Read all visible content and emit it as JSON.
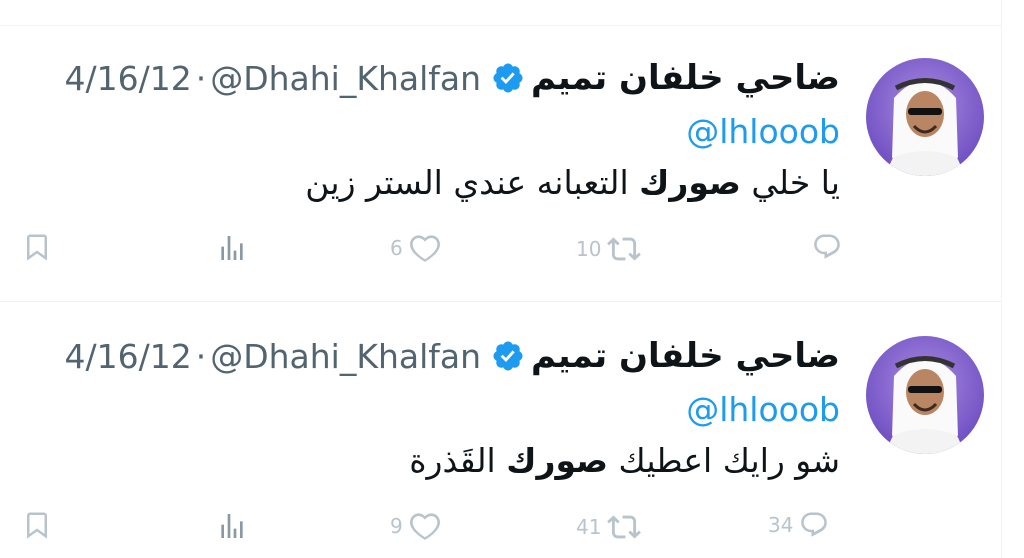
{
  "tweets": [
    {
      "author_name": "ضاحي خلفان تميم",
      "handle": "@Dhahi_Khalfan",
      "separator": "·",
      "date": "4/16/12",
      "reply_to": "@lhlooob",
      "text_parts": [
        "يا خلي ",
        "صورك",
        " التعبانه عندي الستر زين"
      ],
      "stats": {
        "replies": "",
        "retweets": "10",
        "likes": "6"
      }
    },
    {
      "author_name": "ضاحي خلفان تميم",
      "handle": "@Dhahi_Khalfan",
      "separator": "·",
      "date": "4/16/12",
      "reply_to": "@lhlooob",
      "text_parts": [
        "شو رايك اعطيك ",
        "صورك",
        " القَذرة"
      ],
      "stats": {
        "replies": "34",
        "retweets": "41",
        "likes": "9"
      }
    }
  ],
  "icons": {
    "verified": "verified-badge-icon",
    "reply": "reply-icon",
    "retweet": "retweet-icon",
    "like": "heart-icon",
    "views": "analytics-icon",
    "bookmark": "bookmark-icon"
  },
  "colors": {
    "accent": "#1d9bf0",
    "secondary_text": "#536471",
    "action_icons": "#b9c3cc",
    "divider": "#eff3f4"
  }
}
